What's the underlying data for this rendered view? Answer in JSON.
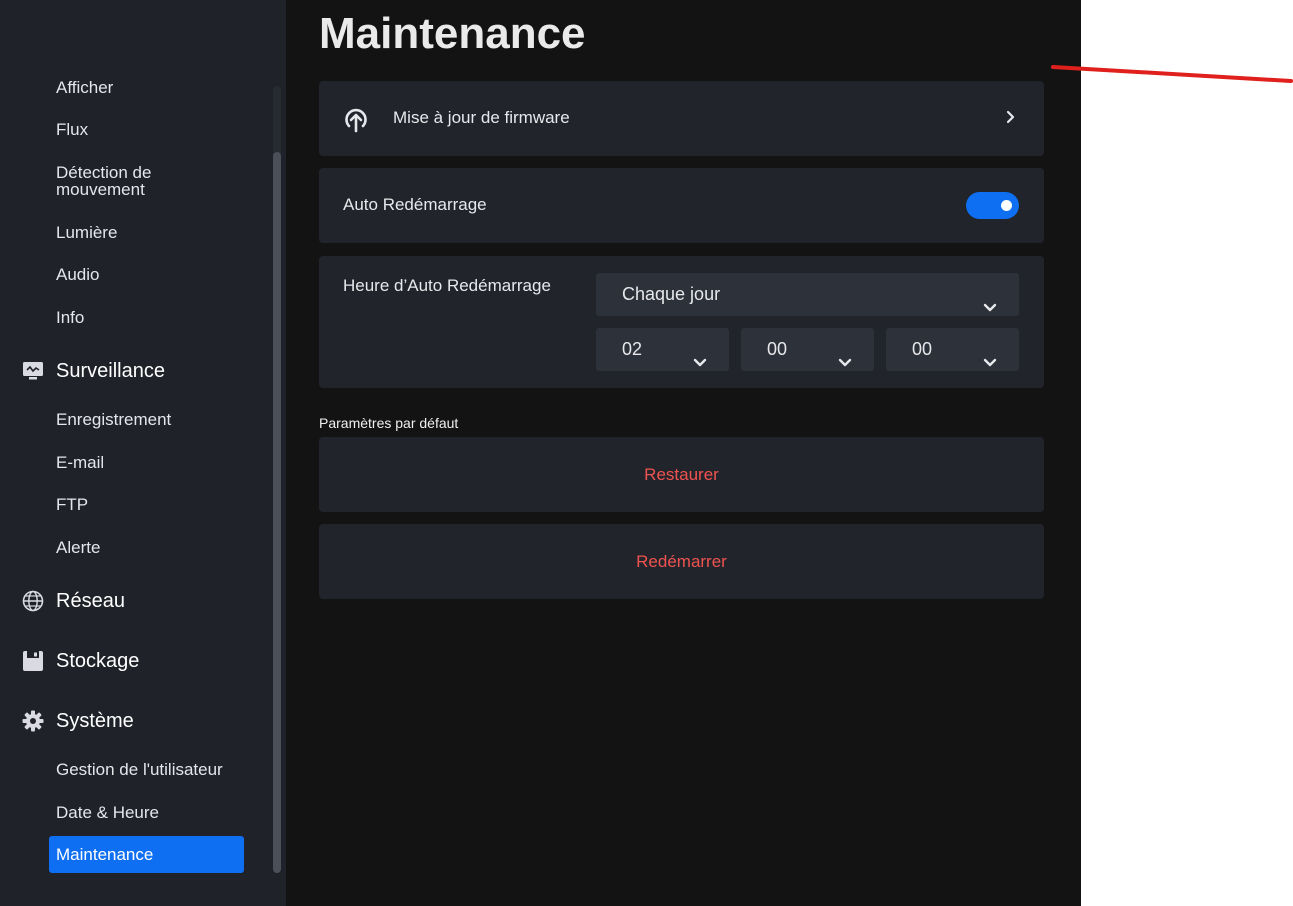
{
  "sidebar": {
    "clipped_item": "Afficher",
    "items_top": [
      "Flux",
      "Détection de mouvement",
      "Lumière",
      "Audio",
      "Info"
    ],
    "sections": {
      "surveillance": {
        "label": "Surveillance",
        "icon": "monitor-icon",
        "items": [
          "Enregistrement",
          "E-mail",
          "FTP",
          "Alerte"
        ]
      },
      "reseau": {
        "label": "Réseau",
        "icon": "globe-icon"
      },
      "stockage": {
        "label": "Stockage",
        "icon": "floppy-disk-icon"
      },
      "systeme": {
        "label": "Système",
        "icon": "gear-icon",
        "items": [
          "Gestion de l'utilisateur",
          "Date & Heure",
          "Maintenance"
        ]
      }
    },
    "active_item": "Maintenance"
  },
  "main": {
    "title": "Maintenance",
    "firmware": {
      "label": "Mise à jour de firmware",
      "icon": "upload-cloud-icon"
    },
    "auto_reboot": {
      "label": "Auto Redémarrage",
      "enabled": true
    },
    "reboot_time": {
      "label": "Heure d’Auto Redémarrage",
      "frequency": "Chaque jour",
      "hour": "02",
      "minute": "00",
      "second": "00"
    },
    "defaults": {
      "caption": "Paramètres par défaut",
      "restore_label": "Restaurer",
      "reboot_label": "Redémarrer"
    }
  },
  "colors": {
    "accent": "#0f6ff2",
    "danger": "#ef5350",
    "annotation": "#e0201c"
  }
}
